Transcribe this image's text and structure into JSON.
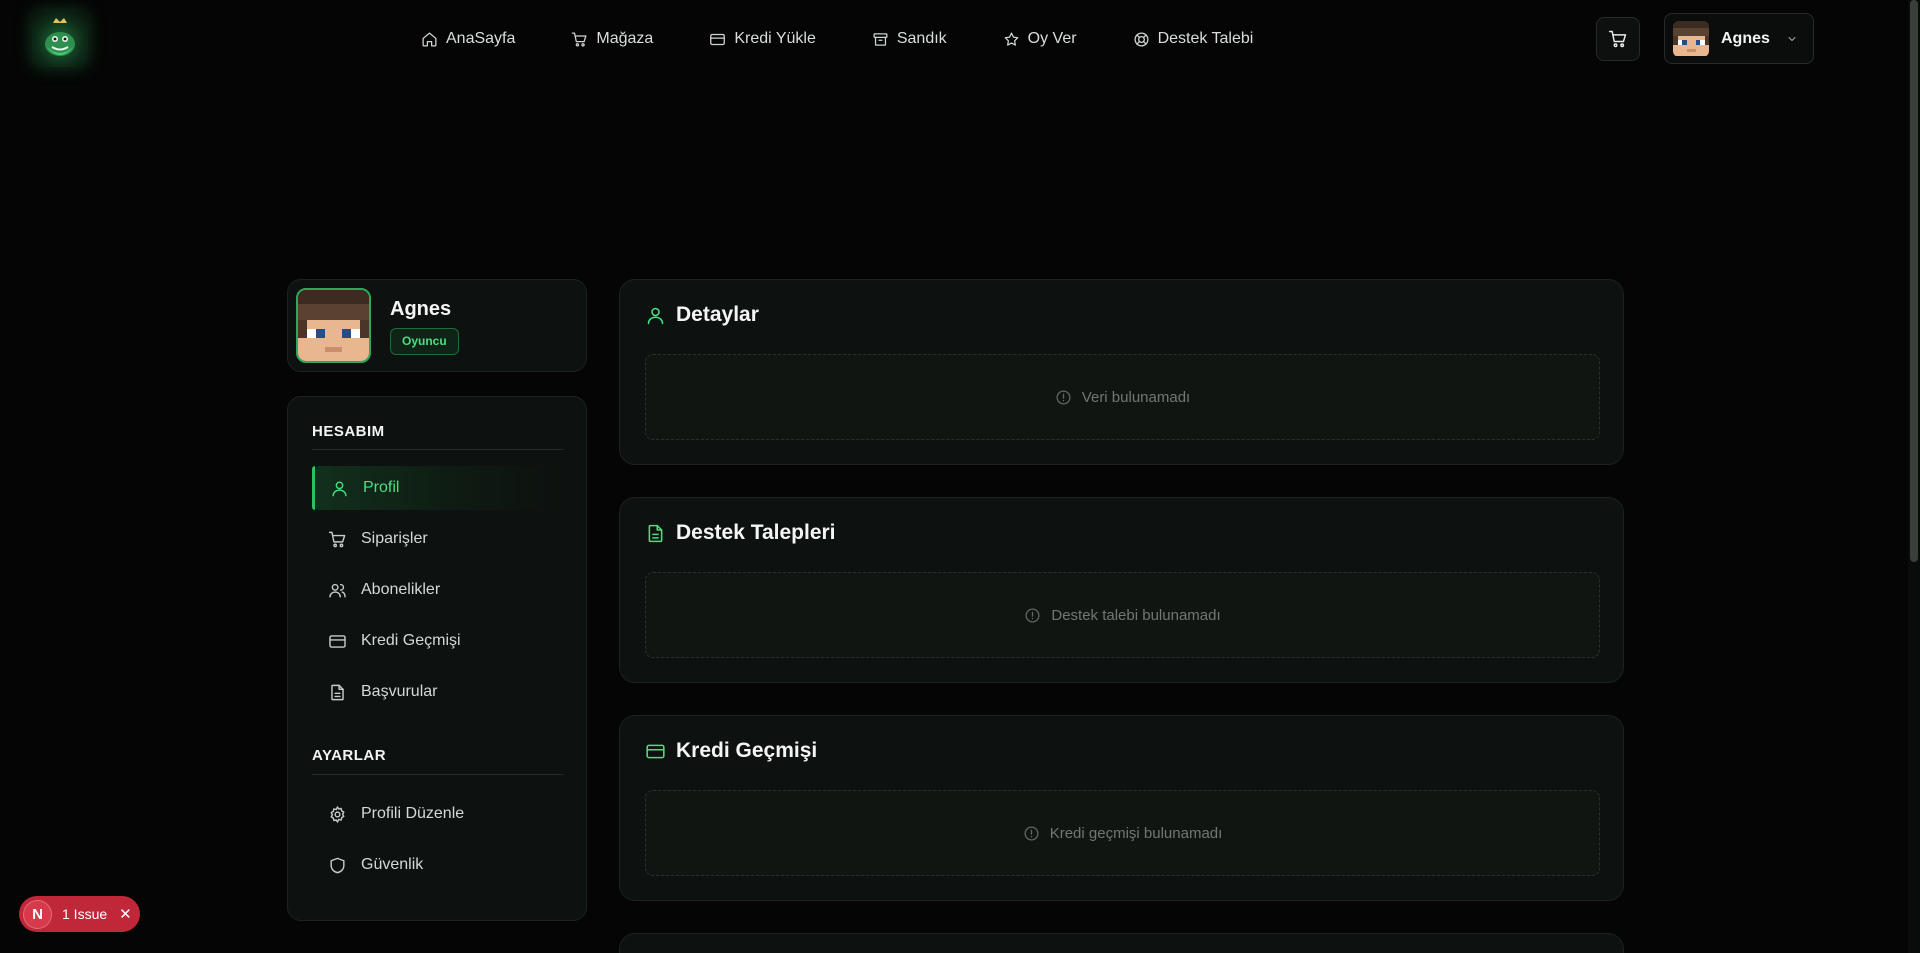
{
  "header": {
    "nav": [
      {
        "label": "AnaSayfa",
        "icon": "home-icon"
      },
      {
        "label": "Mağaza",
        "icon": "shopping-cart-icon"
      },
      {
        "label": "Kredi Yükle",
        "icon": "credit-card-icon"
      },
      {
        "label": "Sandık",
        "icon": "archive-box-icon"
      },
      {
        "label": "Oy Ver",
        "icon": "star-icon"
      },
      {
        "label": "Destek Talebi",
        "icon": "lifebuoy-icon"
      }
    ],
    "user_name": "Agnes"
  },
  "profile": {
    "name": "Agnes",
    "role": "Oyuncu"
  },
  "sidebar": {
    "account_title": "HESABIM",
    "account_items": [
      {
        "label": "Profil",
        "icon": "user-icon",
        "active": true
      },
      {
        "label": "Siparişler",
        "icon": "shopping-cart-icon"
      },
      {
        "label": "Abonelikler",
        "icon": "users-icon"
      },
      {
        "label": "Kredi Geçmişi",
        "icon": "credit-card-icon"
      },
      {
        "label": "Başvurular",
        "icon": "document-icon"
      }
    ],
    "settings_title": "AYARLAR",
    "settings_items": [
      {
        "label": "Profili Düzenle",
        "icon": "gear-icon"
      },
      {
        "label": "Güvenlik",
        "icon": "shield-icon"
      }
    ]
  },
  "cards": [
    {
      "title": "Detaylar",
      "icon": "user-icon",
      "empty_text": "Veri bulunamadı"
    },
    {
      "title": "Destek Talepleri",
      "icon": "document-icon",
      "empty_text": "Destek talebi bulunamadı"
    },
    {
      "title": "Kredi Geçmişi",
      "icon": "credit-card-icon",
      "empty_text": "Kredi geçmişi bulunamadı"
    }
  ],
  "issue_badge": {
    "letter": "N",
    "text": "1 Issue"
  },
  "colors": {
    "accent": "#4ade80",
    "background": "#040504",
    "card": "#0d110f",
    "issue": "#c0283a"
  }
}
